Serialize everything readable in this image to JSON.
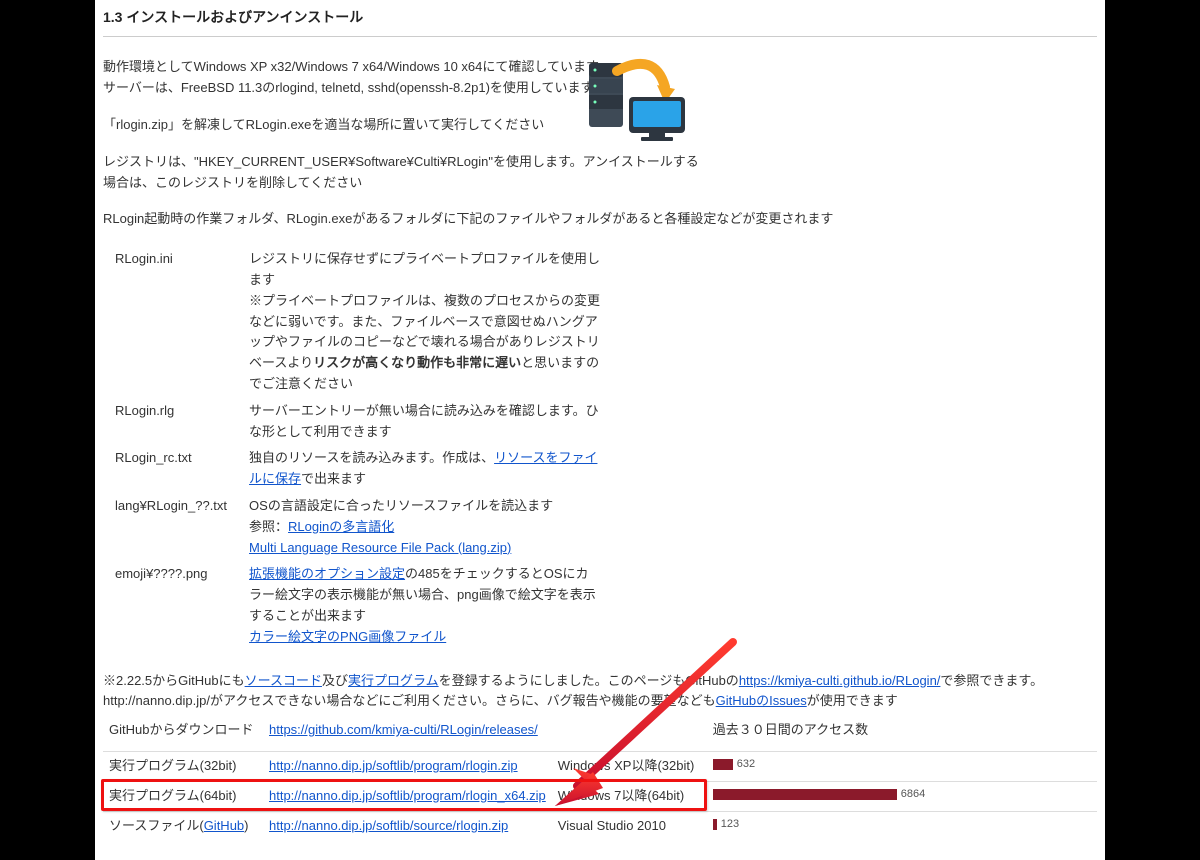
{
  "section": {
    "title": "1.3 インストールおよびアンインストール"
  },
  "intro": {
    "p1": "動作環境としてWindows XP x32/Windows 7 x64/Windows 10 x64にて確認しています",
    "p2": "サーバーは、FreeBSD 11.3のrlogind, telnetd, sshd(openssh-8.2p1)を使用しています",
    "p3": "「rlogin.zip」を解凍してRLogin.exeを適当な場所に置いて実行してください",
    "p4": "レジストリは、\"HKEY_CURRENT_USER¥Software¥Culti¥RLogin\"を使用します。アンイストールする場合は、このレジストリを削除してください",
    "p5": "RLogin起動時の作業フォルダ、RLogin.exeがあるフォルダに下記のファイルやフォルダがあると各種設定などが変更されます"
  },
  "defs": [
    {
      "name": "RLogin.ini",
      "desc_pre": "レジストリに保存せずにプライベートプロファイルを使用します\n※プライベートプロファイルは、複数のプロセスからの変更などに弱いです。また、ファイルベースで意図せぬハングアップやファイルのコピーなどで壊れる場合がありレジストリベースより",
      "desc_bold": "リスクが高くなり動作も非常に遅い",
      "desc_post": "と思いますのでご注意ください"
    },
    {
      "name": "RLogin.rlg",
      "desc": "サーバーエントリーが無い場合に読み込みを確認します。ひな形として利用できます"
    },
    {
      "name": "RLogin_rc.txt",
      "desc_pre": "独自のリソースを読み込みます。作成は、",
      "link_text": "リソースをファイルに保存",
      "desc_post": "で出来ます"
    },
    {
      "name": "lang¥RLogin_??.txt",
      "desc_pre": "OSの言語設定に合ったリソースファイルを読込ます\n参照：",
      "link1_text": "RLoginの多言語化",
      "link2_text": "Multi Language Resource File Pack (lang.zip)"
    },
    {
      "name": "emoji¥????.png",
      "link_text": "拡張機能のオプション設定",
      "desc_mid": "の485をチェックするとOSにカラー絵文字の表示機能が無い場合、png画像で絵文字を表示することが出来ます",
      "link2_text": "カラー絵文字のPNG画像ファイル"
    }
  ],
  "note": {
    "pre1": "※2.22.5からGitHubにも",
    "link1": "ソースコード",
    "mid1": "及び",
    "link2": "実行プログラム",
    "post1": "を登録するようにしました。このページもGitHubの",
    "link3": "https://kmiya-culti.github.io/RLogin/",
    "post2": "で参照できます。http://nanno.dip.jp/がアクセスできない場合などにご利用ください。さらに、バグ報告や機能の要望なども",
    "link4": "GitHubのIssues",
    "post3": "が使用できます"
  },
  "stats_label": "過去３０日間のアクセス数",
  "downloads": [
    {
      "label": "GitHubからダウンロード",
      "url": "https://github.com/kmiya-culti/RLogin/releases/",
      "os": "",
      "count": ""
    },
    {
      "label": "実行プログラム(32bit)",
      "url": "http://nanno.dip.jp/softlib/program/rlogin.zip",
      "os": "Windows XP以降(32bit)",
      "count": "632",
      "bar_w": "20"
    },
    {
      "label": "実行プログラム(64bit)",
      "url": "http://nanno.dip.jp/softlib/program/rlogin_x64.zip",
      "os": "Windows 7以降(64bit)",
      "count": "6864",
      "bar_w": "184"
    },
    {
      "label_pre": "ソースファイル(",
      "label_link": "GitHub",
      "label_post": ")",
      "url": "http://nanno.dip.jp/softlib/source/rlogin.zip",
      "os": "Visual Studio 2010",
      "count": "123",
      "bar_w": "4"
    }
  ]
}
